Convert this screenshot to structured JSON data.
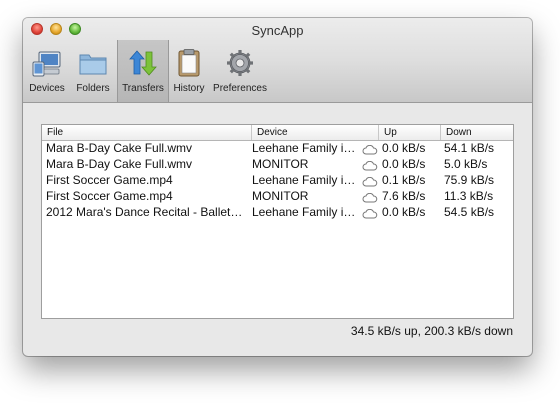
{
  "window": {
    "title": "SyncApp"
  },
  "toolbar": {
    "items": [
      {
        "label": "Devices",
        "icon": "devices-icon",
        "selected": false
      },
      {
        "label": "Folders",
        "icon": "folder-icon",
        "selected": false
      },
      {
        "label": "Transfers",
        "icon": "transfers-icon",
        "selected": true
      },
      {
        "label": "History",
        "icon": "clipboard-icon",
        "selected": false
      },
      {
        "label": "Preferences",
        "icon": "gear-icon",
        "selected": false
      }
    ]
  },
  "table": {
    "columns": [
      "File",
      "Device",
      "Up",
      "Down"
    ],
    "rows": [
      {
        "file": "Mara B-Day Cake Full.wmv",
        "device": "Leehane Family i…",
        "up": "0.0 kB/s",
        "down": "54.1 kB/s"
      },
      {
        "file": "Mara B-Day Cake Full.wmv",
        "device": "MONITOR",
        "up": "0.0 kB/s",
        "down": "5.0 kB/s"
      },
      {
        "file": "First Soccer Game.mp4",
        "device": "Leehane Family i…",
        "up": "0.1 kB/s",
        "down": "75.9 kB/s"
      },
      {
        "file": "First Soccer Game.mp4",
        "device": "MONITOR",
        "up": "7.6 kB/s",
        "down": "11.3 kB/s"
      },
      {
        "file": "2012 Mara's Dance Recital - Ballet…",
        "device": "Leehane Family i…",
        "up": "0.0 kB/s",
        "down": "54.5 kB/s"
      }
    ]
  },
  "status": {
    "text": "34.5 kB/s up, 200.3 kB/s down"
  }
}
